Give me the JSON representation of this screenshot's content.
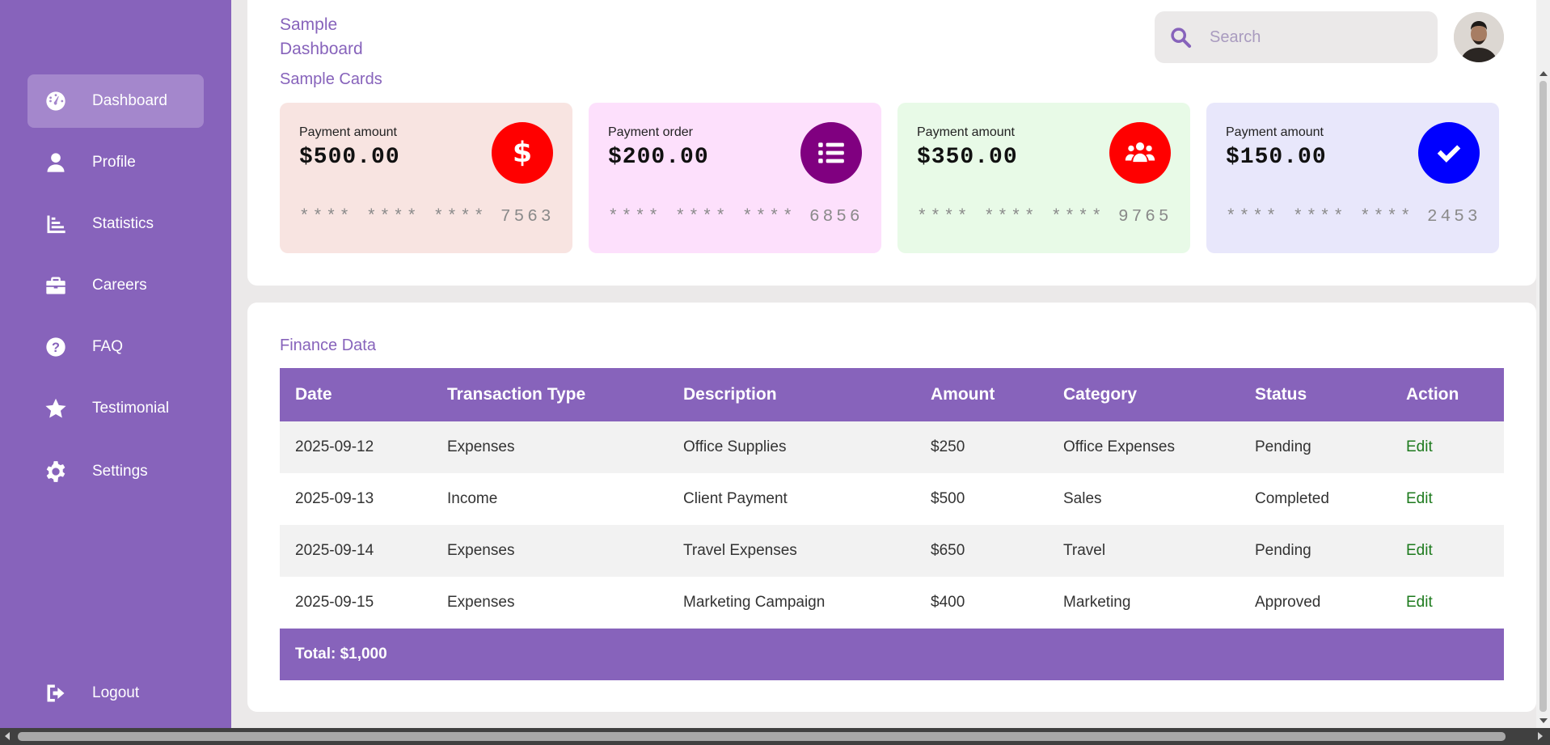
{
  "sidebar": {
    "items": [
      {
        "label": "Dashboard",
        "icon": "gauge-icon"
      },
      {
        "label": "Profile",
        "icon": "user-icon"
      },
      {
        "label": "Statistics",
        "icon": "bar-chart-icon"
      },
      {
        "label": "Careers",
        "icon": "briefcase-icon"
      },
      {
        "label": "FAQ",
        "icon": "question-icon"
      },
      {
        "label": "Testimonial",
        "icon": "star-icon"
      },
      {
        "label": "Settings",
        "icon": "gear-icon"
      }
    ],
    "logout_label": "Logout",
    "active_item": "Dashboard",
    "color": "#8763bb"
  },
  "header": {
    "brand": "Sample Dashboard",
    "search_placeholder": "Search"
  },
  "cards_section": {
    "title": "Sample Cards",
    "cards": [
      {
        "label": "Payment amount",
        "amount": "$500.00",
        "number": "**** **** **** 7563",
        "icon": "dollar-icon",
        "bg": "#f8e4e1",
        "icon_bg": "#ff0000"
      },
      {
        "label": "Payment order",
        "amount": "$200.00",
        "number": "**** **** **** 6856",
        "icon": "list-icon",
        "bg": "#fde0fc",
        "icon_bg": "#800080"
      },
      {
        "label": "Payment amount",
        "amount": "$350.00",
        "number": "**** **** **** 9765",
        "icon": "users-icon",
        "bg": "#e8fae7",
        "icon_bg": "#ff0000"
      },
      {
        "label": "Payment amount",
        "amount": "$150.00",
        "number": "**** **** **** 2453",
        "icon": "check-icon",
        "bg": "#e8e7fb",
        "icon_bg": "#0000ff"
      }
    ]
  },
  "finance": {
    "title": "Finance Data",
    "columns": [
      "Date",
      "Transaction Type",
      "Description",
      "Amount",
      "Category",
      "Status",
      "Action"
    ],
    "rows": [
      [
        "2025-09-12",
        "Expenses",
        "Office Supplies",
        "$250",
        "Office Expenses",
        "Pending",
        "Edit"
      ],
      [
        "2025-09-13",
        "Income",
        "Client Payment",
        "$500",
        "Sales",
        "Completed",
        "Edit"
      ],
      [
        "2025-09-14",
        "Expenses",
        "Travel Expenses",
        "$650",
        "Travel",
        "Pending",
        "Edit"
      ],
      [
        "2025-09-15",
        "Expenses",
        "Marketing Campaign",
        "$400",
        "Marketing",
        "Approved",
        "Edit"
      ]
    ],
    "total": "Total: $1,000"
  }
}
